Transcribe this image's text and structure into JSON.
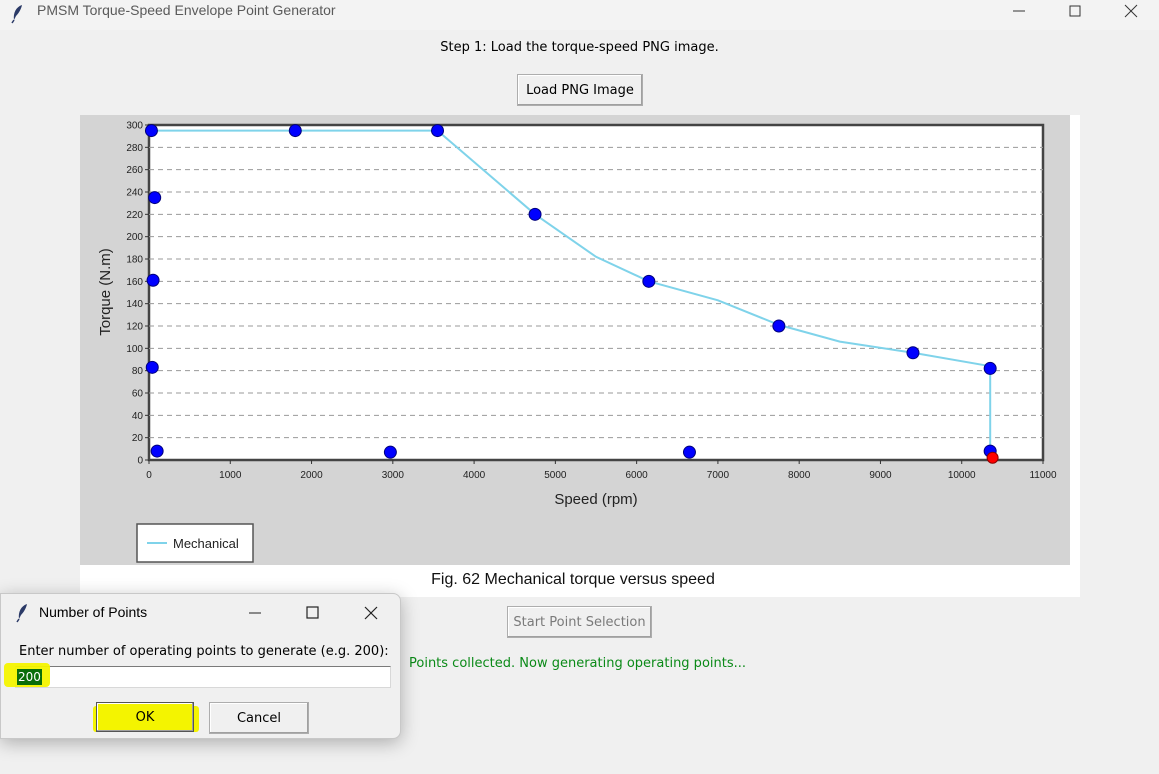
{
  "window": {
    "title": "PMSM Torque-Speed Envelope Point Generator"
  },
  "main": {
    "step_label": "Step 1: Load the torque-speed PNG image.",
    "load_button": "Load PNG Image",
    "start_button": "Start Point Selection",
    "status": "Points collected. Now generating operating points..."
  },
  "chart_data": {
    "type": "line",
    "title": "Fig. 62 Mechanical torque versus speed",
    "xlabel": "Speed (rpm)",
    "ylabel": "Torque (N.m)",
    "xlim": [
      0,
      11000
    ],
    "ylim": [
      0,
      300
    ],
    "xticks": [
      "0",
      "1000",
      "2000",
      "3000",
      "4000",
      "5000",
      "6000",
      "7000",
      "8000",
      "9000",
      "10000",
      "11000"
    ],
    "yticks": [
      "0",
      "20",
      "40",
      "60",
      "80",
      "100",
      "120",
      "140",
      "160",
      "180",
      "200",
      "220",
      "240",
      "260",
      "280",
      "300"
    ],
    "grid": "horizontal dashed",
    "legend_position": "bottom-left",
    "line_color": "#7fd3ea",
    "series": [
      {
        "name": "Mechanical",
        "x": [
          0,
          3550,
          4750,
          5500,
          6150,
          7000,
          7750,
          8500,
          9400,
          10350,
          10350
        ],
        "y": [
          295,
          295,
          220,
          182,
          160,
          143,
          121,
          106,
          96,
          84,
          0
        ]
      }
    ],
    "selected_points": {
      "color": "#0000ff",
      "x": [
        30,
        1800,
        3550,
        4750,
        6150,
        7750,
        9400,
        10350,
        70,
        50,
        40,
        100,
        2970,
        6650,
        10350
      ],
      "y": [
        295,
        295,
        295,
        220,
        160,
        120,
        96,
        82,
        235,
        161,
        83,
        8,
        7,
        7,
        8
      ]
    },
    "current_point": {
      "color": "#ff0000",
      "x": 10380,
      "y": 2
    }
  },
  "dialog": {
    "title": "Number of Points",
    "prompt": "Enter number of operating points to generate (e.g. 200):",
    "input_value": "200",
    "ok_label": "OK",
    "cancel_label": "Cancel"
  },
  "colors": {
    "status_text": "#0b8a18",
    "highlight": "#f4f400",
    "plot_panel": "#d4d4d4"
  }
}
